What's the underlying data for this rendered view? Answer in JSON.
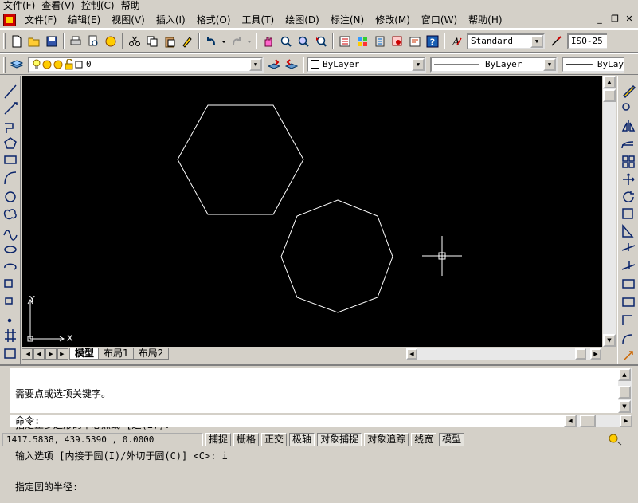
{
  "outer_menu": [
    "文件(F)",
    "查看(V)",
    "控制(C)",
    "帮助"
  ],
  "app_menu": [
    "文件(F)",
    "编辑(E)",
    "视图(V)",
    "插入(I)",
    "格式(O)",
    "工具(T)",
    "绘图(D)",
    "标注(N)",
    "修改(M)",
    "窗口(W)",
    "帮助(H)"
  ],
  "window_controls": [
    "_",
    "❐",
    "✕"
  ],
  "styles": {
    "text_style": "Standard",
    "dim_style": "ISO-25"
  },
  "layer": {
    "current": "0"
  },
  "properties": {
    "color": "ByLayer",
    "linetype": "ByLayer",
    "lineweight": "ByLay"
  },
  "tabs": [
    "模型",
    "布局1",
    "布局2"
  ],
  "ucs": {
    "x_label": "X",
    "y_label": "Y"
  },
  "command_history": [
    "需要点或选项关键字。",
    "指定正多边形的中心点或 [边(E)]:",
    "输入选项 [内接于圆(I)/外切于圆(C)] <C>: i",
    "指定圆的半径:"
  ],
  "command_prompt": "命令:",
  "status": {
    "coordinates": "1417.5838, 439.5390 , 0.0000",
    "toggles": [
      "捕捉",
      "栅格",
      "正交",
      "极轴",
      "对象捕捉",
      "对象追踪",
      "线宽",
      "模型"
    ],
    "active_toggles": [
      "极轴",
      "对象捕捉",
      "模型"
    ]
  },
  "colors": {
    "canvas": "#000000",
    "drawing": "#ffffff",
    "chrome": "#d4d0c8"
  }
}
